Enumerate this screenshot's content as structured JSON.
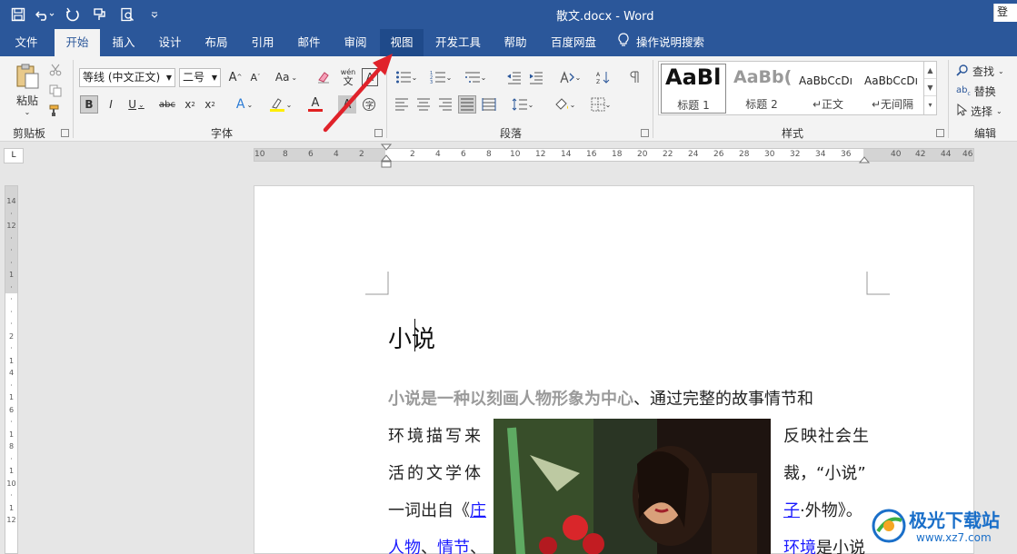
{
  "app": {
    "title": "散文.docx  -  Word",
    "login_label": "登"
  },
  "tabs": [
    {
      "label": "文件"
    },
    {
      "label": "开始"
    },
    {
      "label": "插入"
    },
    {
      "label": "设计"
    },
    {
      "label": "布局"
    },
    {
      "label": "引用"
    },
    {
      "label": "邮件"
    },
    {
      "label": "审阅"
    },
    {
      "label": "视图"
    },
    {
      "label": "开发工具"
    },
    {
      "label": "帮助"
    },
    {
      "label": "百度网盘"
    }
  ],
  "tell_me": "操作说明搜索",
  "ribbon": {
    "clipboard": {
      "paste_label": "粘贴",
      "group_label": "剪贴板"
    },
    "font": {
      "font_name": "等线 (中文正文)",
      "font_size": "二号",
      "group_label": "字体",
      "aa_label": "Aa",
      "wen_label": "wén"
    },
    "paragraph": {
      "group_label": "段落"
    },
    "styles": {
      "group_label": "样式",
      "items": [
        {
          "sample": "AaBl",
          "name": "标题 1"
        },
        {
          "sample": "AaBb(",
          "name": "标题 2"
        },
        {
          "sample": "AaBbCcDı",
          "name": "正文"
        },
        {
          "sample": "AaBbCcDı",
          "name": "无间隔"
        }
      ]
    },
    "editing": {
      "group_label": "编辑",
      "find": "查找",
      "replace": "替换",
      "select": "选择"
    }
  },
  "ruler": {
    "h_numbers": [
      "10",
      "8",
      "6",
      "4",
      "2",
      "2",
      "4",
      "6",
      "8",
      "10",
      "12",
      "14",
      "16",
      "18",
      "20",
      "22",
      "24",
      "26",
      "28",
      "30",
      "32",
      "34",
      "36",
      "40",
      "42",
      "44",
      "46"
    ],
    "v_numbers": [
      "14",
      "12",
      "1",
      "2",
      "1",
      "4",
      "1",
      "6",
      "1",
      "8",
      "1",
      "10",
      "1",
      "12"
    ]
  },
  "document": {
    "title_left": "小",
    "title_right": "说",
    "p1_bold": "小说是一种以刻画人物形象为中心",
    "p1_rest": "、通过完整的故事情节和",
    "l2_left": "环境描写来",
    "l2_right": "反映社会生",
    "l3_left": "活的文学体",
    "l3_right": "裁，“小说”",
    "l4_left_text": "一词出自《",
    "l4_left_link": "庄",
    "l4_right_link": "子",
    "l4_right_text": "·外物》。",
    "l5_left_link1": "人物",
    "l5_left_sep": "、",
    "l5_left_link2": "情节",
    "l5_left_tail": "、",
    "l5_right_link": "环境",
    "l5_right_text": "是小说"
  },
  "watermark": {
    "name": "极光下载站",
    "url": "www.xz7.com"
  },
  "colors": {
    "title_bar": "#2b579a",
    "ribbon": "#f3f3f3",
    "arrow": "#e0222a",
    "link": "#1a1aff"
  }
}
